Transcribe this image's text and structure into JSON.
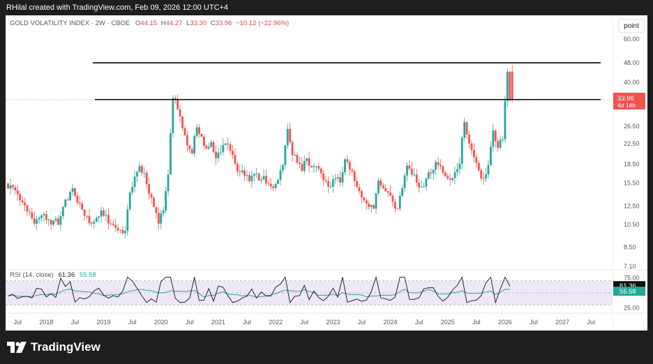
{
  "header": {
    "author_line": "RHilal created with TradingView.com, Feb 09, 2026 12:00 UTC+4"
  },
  "legend": {
    "symbol": "GOLD VOLATILITY INDEX · 2W · CBOE",
    "o_label": "O",
    "o_value": "44.15",
    "h_label": "H",
    "h_value": "44.27",
    "l_label": "L",
    "l_value": "33.30",
    "c_label": "C",
    "c_value": "33.96",
    "change": "−10.12 (−22.96%)"
  },
  "rsi_legend": {
    "label": "RSI (14, close)",
    "rsi_value": "61.36",
    "ma_value": "55.58"
  },
  "toolbar": {
    "scale_button": "point"
  },
  "price_badge": {
    "price": "33.96",
    "countdown": "4d 14h"
  },
  "rsi_badges": {
    "rsi": "61.36",
    "ma": "55.58"
  },
  "footer": {
    "brand": "TradingView"
  },
  "colors": {
    "up": "#26a69a",
    "down": "#ef5350",
    "rsi_line": "#111111",
    "rsi_ma": "#26a69a",
    "rsi_band": "#ede7f6"
  },
  "chart_data": {
    "type": "candlestick",
    "title": "GOLD VOLATILITY INDEX · 2W · CBOE",
    "y_scale": "log",
    "y_ticks": [
      "60.00",
      "48.00",
      "40.00",
      "33.96",
      "26.50",
      "22.50",
      "18.50",
      "15.50",
      "12.50",
      "10.50",
      "8.50",
      "7.10"
    ],
    "x_ticks": [
      "Jul",
      "2018",
      "Jul",
      "2019",
      "Jul",
      "2020",
      "Jul",
      "2021",
      "Jul",
      "2022",
      "Jul",
      "2023",
      "Jul",
      "2024",
      "Jul",
      "2025",
      "Jul",
      "2026",
      "Jul",
      "2027",
      "Jul"
    ],
    "horizontal_levels": [
      48.0,
      34.0
    ],
    "last_close": 33.96,
    "last_candle": {
      "open": 44.15,
      "high": 44.27,
      "low": 33.3,
      "close": 33.96
    },
    "candles": [
      {
        "t": "2017-05",
        "c": 15.2
      },
      {
        "t": "2017-06",
        "c": 14.5
      },
      {
        "t": "2017-07",
        "c": 13.2
      },
      {
        "t": "2017-08",
        "c": 12.6
      },
      {
        "t": "2017-09",
        "c": 11.8
      },
      {
        "t": "2017-10",
        "c": 10.6
      },
      {
        "t": "2017-11",
        "c": 11.2
      },
      {
        "t": "2017-12",
        "c": 11.6
      },
      {
        "t": "2018-01",
        "c": 11.0
      },
      {
        "t": "2018-02",
        "c": 10.9
      },
      {
        "t": "2018-03",
        "c": 10.5
      },
      {
        "t": "2018-04",
        "c": 12.4
      },
      {
        "t": "2018-05",
        "c": 13.2
      },
      {
        "t": "2018-06",
        "c": 14.8
      },
      {
        "t": "2018-07",
        "c": 12.9
      },
      {
        "t": "2018-08",
        "c": 12.1
      },
      {
        "t": "2018-09",
        "c": 11.4
      },
      {
        "t": "2018-10",
        "c": 10.6
      },
      {
        "t": "2018-11",
        "c": 11.2
      },
      {
        "t": "2018-12",
        "c": 12.0
      },
      {
        "t": "2019-01",
        "c": 11.5
      },
      {
        "t": "2019-02",
        "c": 10.6
      },
      {
        "t": "2019-03",
        "c": 10.2
      },
      {
        "t": "2019-04",
        "c": 10.0
      },
      {
        "t": "2019-05",
        "c": 9.9
      },
      {
        "t": "2019-06",
        "c": 14.2
      },
      {
        "t": "2019-07",
        "c": 16.5
      },
      {
        "t": "2019-08",
        "c": 18.2
      },
      {
        "t": "2019-09",
        "c": 17.1
      },
      {
        "t": "2019-10",
        "c": 14.0
      },
      {
        "t": "2019-11",
        "c": 12.4
      },
      {
        "t": "2019-12",
        "c": 10.6
      },
      {
        "t": "2020-01",
        "c": 12.0
      },
      {
        "t": "2020-02",
        "c": 16.8
      },
      {
        "t": "2020-03",
        "c": 34.5
      },
      {
        "t": "2020-04",
        "c": 31.0
      },
      {
        "t": "2020-05",
        "c": 26.0
      },
      {
        "t": "2020-06",
        "c": 22.1
      },
      {
        "t": "2020-07",
        "c": 20.5
      },
      {
        "t": "2020-08",
        "c": 26.2
      },
      {
        "t": "2020-09",
        "c": 24.0
      },
      {
        "t": "2020-10",
        "c": 21.5
      },
      {
        "t": "2020-11",
        "c": 22.8
      },
      {
        "t": "2020-12",
        "c": 19.6
      },
      {
        "t": "2021-01",
        "c": 20.8
      },
      {
        "t": "2021-02",
        "c": 22.5
      },
      {
        "t": "2021-03",
        "c": 21.0
      },
      {
        "t": "2021-04",
        "c": 18.6
      },
      {
        "t": "2021-05",
        "c": 17.2
      },
      {
        "t": "2021-06",
        "c": 16.6
      },
      {
        "t": "2021-07",
        "c": 15.8
      },
      {
        "t": "2021-08",
        "c": 16.9
      },
      {
        "t": "2021-09",
        "c": 15.9
      },
      {
        "t": "2021-10",
        "c": 16.6
      },
      {
        "t": "2021-11",
        "c": 15.4
      },
      {
        "t": "2021-12",
        "c": 14.8
      },
      {
        "t": "2022-01",
        "c": 16.0
      },
      {
        "t": "2022-02",
        "c": 18.4
      },
      {
        "t": "2022-03",
        "c": 25.8
      },
      {
        "t": "2022-04",
        "c": 20.2
      },
      {
        "t": "2022-05",
        "c": 18.8
      },
      {
        "t": "2022-06",
        "c": 17.4
      },
      {
        "t": "2022-07",
        "c": 19.6
      },
      {
        "t": "2022-08",
        "c": 18.0
      },
      {
        "t": "2022-09",
        "c": 18.2
      },
      {
        "t": "2022-10",
        "c": 17.0
      },
      {
        "t": "2022-11",
        "c": 15.8
      },
      {
        "t": "2022-12",
        "c": 15.0
      },
      {
        "t": "2023-01",
        "c": 16.2
      },
      {
        "t": "2023-02",
        "c": 15.6
      },
      {
        "t": "2023-03",
        "c": 19.4
      },
      {
        "t": "2023-04",
        "c": 17.6
      },
      {
        "t": "2023-05",
        "c": 15.8
      },
      {
        "t": "2023-06",
        "c": 14.4
      },
      {
        "t": "2023-07",
        "c": 13.2
      },
      {
        "t": "2023-08",
        "c": 12.4
      },
      {
        "t": "2023-09",
        "c": 12.2
      },
      {
        "t": "2023-10",
        "c": 15.9
      },
      {
        "t": "2023-11",
        "c": 14.8
      },
      {
        "t": "2023-12",
        "c": 14.2
      },
      {
        "t": "2024-01",
        "c": 13.0
      },
      {
        "t": "2024-02",
        "c": 12.2
      },
      {
        "t": "2024-03",
        "c": 14.8
      },
      {
        "t": "2024-04",
        "c": 18.3
      },
      {
        "t": "2024-05",
        "c": 16.8
      },
      {
        "t": "2024-06",
        "c": 15.6
      },
      {
        "t": "2024-07",
        "c": 15.0
      },
      {
        "t": "2024-08",
        "c": 16.2
      },
      {
        "t": "2024-09",
        "c": 17.0
      },
      {
        "t": "2024-10",
        "c": 18.9
      },
      {
        "t": "2024-11",
        "c": 18.2
      },
      {
        "t": "2024-12",
        "c": 16.6
      },
      {
        "t": "2025-01",
        "c": 16.0
      },
      {
        "t": "2025-02",
        "c": 17.2
      },
      {
        "t": "2025-03",
        "c": 18.6
      },
      {
        "t": "2025-04",
        "c": 27.5
      },
      {
        "t": "2025-05",
        "c": 22.5
      },
      {
        "t": "2025-06",
        "c": 19.8
      },
      {
        "t": "2025-07",
        "c": 17.5
      },
      {
        "t": "2025-08",
        "c": 16.2
      },
      {
        "t": "2025-09",
        "c": 18.4
      },
      {
        "t": "2025-10",
        "c": 25.4
      },
      {
        "t": "2025-11",
        "c": 21.6
      },
      {
        "t": "2025-12",
        "c": 23.4
      },
      {
        "t": "2026-01",
        "c": 44.15
      },
      {
        "t": "2026-02",
        "c": 33.96
      }
    ],
    "rsi": {
      "period": 14,
      "levels": [
        70,
        50,
        30
      ],
      "y_ticks": [
        "75.00",
        "50.00",
        "25.00"
      ],
      "last_rsi": 61.36,
      "last_ma": 55.58
    }
  }
}
